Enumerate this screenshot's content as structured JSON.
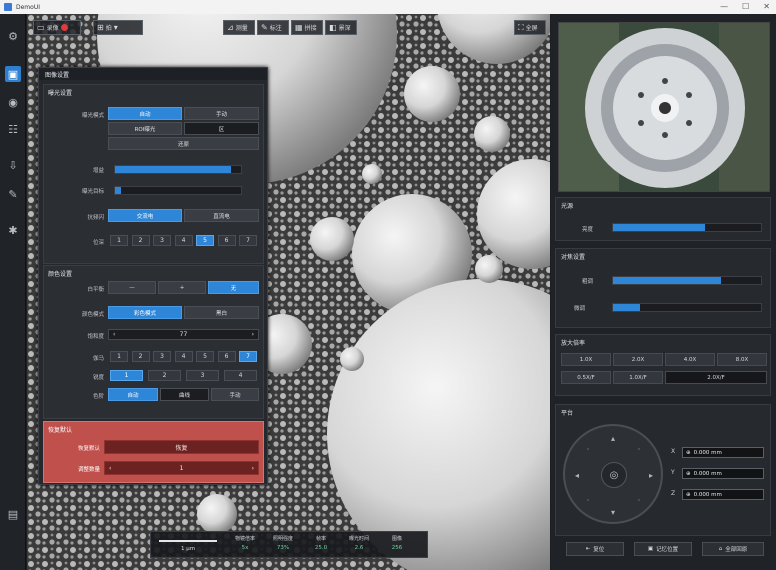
{
  "window": {
    "title": "DemoUI",
    "controls": [
      "—",
      "☐",
      "✕"
    ]
  },
  "toolbar": {
    "left_buttons": [
      {
        "label": "录像",
        "icon": "record-icon"
      },
      {
        "label": "拍",
        "icon": "grid-icon"
      }
    ],
    "center_buttons": [
      {
        "label": "测量",
        "icon": "measure-icon"
      },
      {
        "label": "标注",
        "icon": "annotate-icon"
      },
      {
        "label": "拼接",
        "icon": "stitch-icon"
      },
      {
        "label": "景深",
        "icon": "depth-icon"
      }
    ],
    "right_button": {
      "label": "全屏",
      "icon": "fullscreen-icon"
    }
  },
  "sidebar": {
    "icons": [
      "settings-icon",
      "image-icon",
      "camera-icon",
      "layout-icon",
      "export-icon",
      "tool-icon",
      "gear-icon",
      "file-icon"
    ]
  },
  "panel": {
    "title": "图像设置",
    "exposure": {
      "title": "曝光设置",
      "mode_label": "曝光模式",
      "mode_options": [
        "自动",
        "手动",
        "ROI曝光",
        "区"
      ],
      "mode_selected": "自动",
      "reset_label": "还原",
      "gain_label": "增益",
      "gain_value": 0.92,
      "target_label": "曝光目标",
      "target_value": 0.05,
      "flicker_label": "抗频闪",
      "flicker_options": [
        "交流电",
        "直流电"
      ],
      "flicker_selected": "交流电",
      "bit_label": "位深",
      "bit_options": [
        "1",
        "2",
        "3",
        "4",
        "5",
        "6",
        "7"
      ],
      "bit_selected": "5"
    },
    "color": {
      "title": "颜色设置",
      "wb_label": "白平衡",
      "wb_options": [
        "—",
        "+",
        "无"
      ],
      "wb_selected": "无",
      "mode_label": "颜色模式",
      "mode_options": [
        "彩色模式",
        "黑白"
      ],
      "mode_selected": "彩色模式",
      "sat_label": "饱和度",
      "sat_value": "77",
      "gamma_label": "伽马",
      "gamma_options": [
        "1",
        "2",
        "3",
        "4",
        "5",
        "6",
        "7"
      ],
      "gamma_selected": "7",
      "sharp_label": "锐度",
      "sharp_options": [
        "1",
        "2",
        "3",
        "4"
      ],
      "sharp_selected": "1",
      "lut_label": "色阶",
      "lut_options": [
        "自动",
        "曲线",
        "手动"
      ],
      "lut_selected": "自动"
    },
    "reset": {
      "title": "恢复默认",
      "default_label": "恢复默认",
      "default_value": "恢复",
      "count_label": "调整数量",
      "count_value": "1"
    }
  },
  "statusbar": {
    "scale_text": "1 μm",
    "stats": [
      {
        "label": "物镜倍率",
        "value": "5x"
      },
      {
        "label": "照明强度",
        "value": "73%"
      },
      {
        "label": "帧率",
        "value": "25.0"
      },
      {
        "label": "曝光时间",
        "value": "2.6"
      },
      {
        "label": "图像",
        "value": "256"
      }
    ]
  },
  "right": {
    "light": {
      "title": "光源",
      "label": "亮度",
      "value": 0.62
    },
    "focus": {
      "title": "对焦设置",
      "coarse_label": "粗调",
      "coarse_value": 0.73,
      "fine_label": "微调",
      "fine_value": 0.18
    },
    "magnify": {
      "title": "放大倍率",
      "row1": [
        "1.0X",
        "2.0X",
        "4.0X",
        "8.0X"
      ],
      "row2": [
        "0.5X/F",
        "1.0X/F",
        "2.0X/F"
      ],
      "row2_selected": "2.0X/F"
    },
    "stage": {
      "title": "平台",
      "coords": [
        {
          "axis": "X",
          "value": "0.000 mm"
        },
        {
          "axis": "Y",
          "value": "0.000 mm"
        },
        {
          "axis": "Z",
          "value": "0.000 mm"
        }
      ]
    },
    "bottom_buttons": [
      {
        "label": "复位",
        "icon": "reset-icon"
      },
      {
        "label": "记忆位置",
        "icon": "save-position-icon"
      },
      {
        "label": "全部回原",
        "icon": "home-icon"
      }
    ]
  }
}
